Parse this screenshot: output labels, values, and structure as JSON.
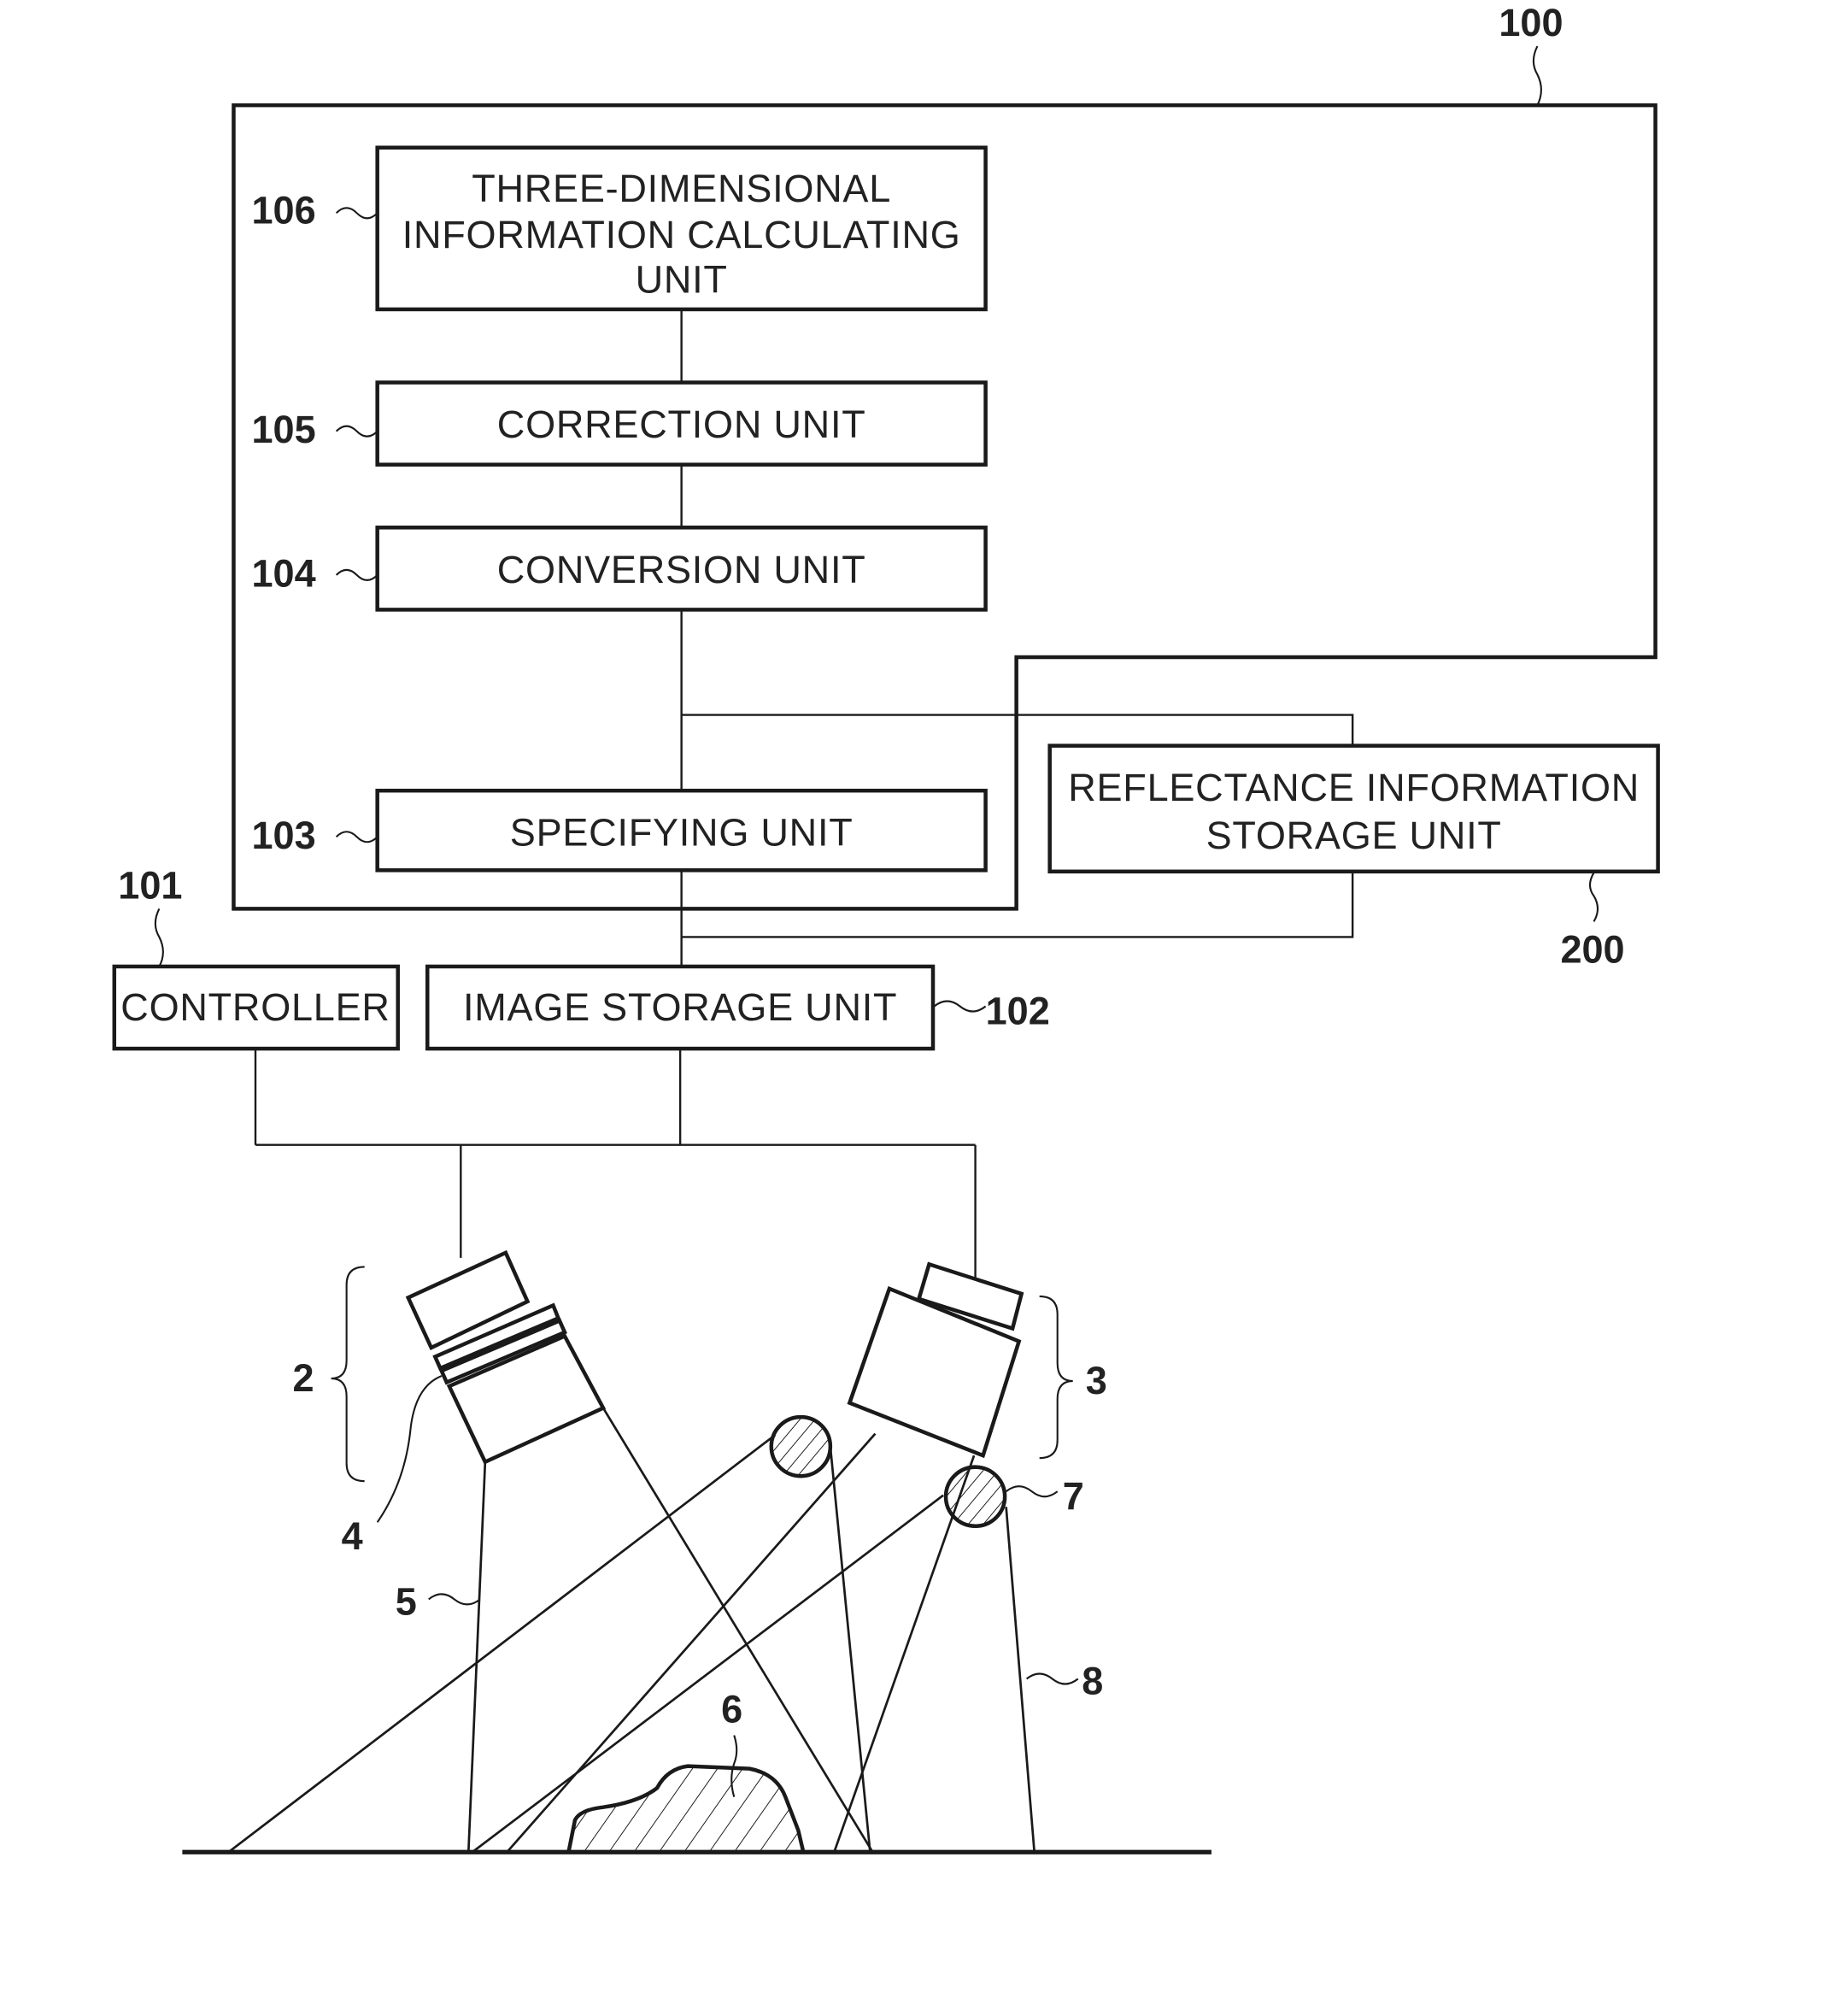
{
  "figure": {
    "system_ref": "100",
    "units": [
      {
        "id": "106",
        "lines": [
          "THREE-DIMENSIONAL",
          "INFORMATION CALCULATING",
          "UNIT"
        ]
      },
      {
        "id": "105",
        "lines": [
          "CORRECTION UNIT"
        ]
      },
      {
        "id": "104",
        "lines": [
          "CONVERSION UNIT"
        ]
      },
      {
        "id": "103",
        "lines": [
          "SPECIFYING UNIT"
        ]
      }
    ],
    "reflectance_storage": {
      "id": "200",
      "lines": [
        "REFLECTANCE INFORMATION",
        "STORAGE UNIT"
      ]
    },
    "controller": {
      "id": "101",
      "label": "CONTROLLER"
    },
    "image_storage": {
      "id": "102",
      "label": "IMAGE STORAGE UNIT"
    },
    "optical_refs": {
      "projector": "2",
      "camera": "3",
      "filter": "4",
      "projection_range": "5",
      "object": "6",
      "light_source": "7",
      "imaging_range": "8"
    }
  }
}
